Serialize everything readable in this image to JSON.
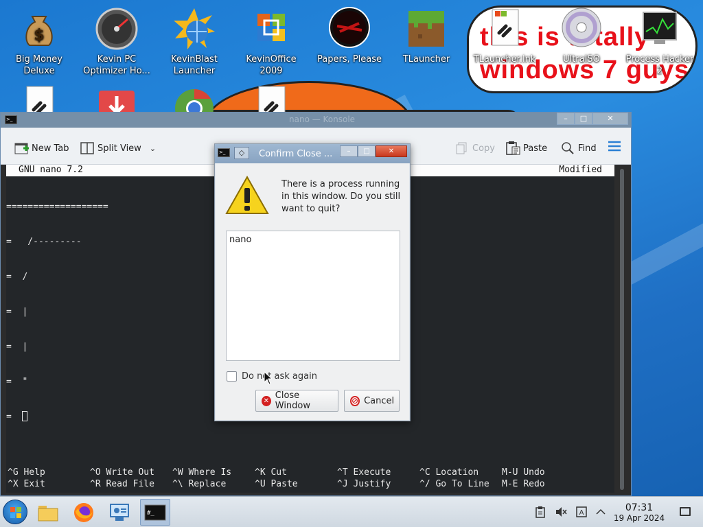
{
  "desktop": {
    "icons": [
      {
        "label": "Big Money\nDeluxe",
        "icon": "money-bag-icon"
      },
      {
        "label": "Kevin PC\nOptimizer Ho...",
        "icon": "speedometer-icon"
      },
      {
        "label": "KevinBlast\nLauncher",
        "icon": "blast-globe-icon"
      },
      {
        "label": "KevinOffice\n2009",
        "icon": "office-logo-icon"
      },
      {
        "label": "Papers, Please",
        "icon": "papers-please-icon"
      },
      {
        "label": "TLauncher",
        "icon": "grass-block-icon"
      },
      {
        "label": "TLauncher.lnk",
        "icon": "shortcut-file-icon"
      },
      {
        "label": "UltraISO",
        "icon": "disc-icon"
      },
      {
        "label": "Process Hacker\n2",
        "icon": "process-hacker-icon"
      }
    ],
    "sticker": {
      "line1": "this is totally",
      "line2": "windows 7 guys"
    }
  },
  "terminal": {
    "window_title": "nano — Konsole",
    "toolbar": {
      "new_tab": "New Tab",
      "split_view": "Split View",
      "copy": "Copy",
      "paste": "Paste",
      "find": "Find"
    },
    "nano": {
      "header_left": "GNU nano 7.2",
      "header_right": "Modified",
      "lines": [
        "===================",
        "=   /---------",
        "=  /",
        "=  |",
        "=  |",
        "=  \""
      ],
      "last_line_prefix": "=  ",
      "help": [
        {
          "key": "^G",
          "label": "Help"
        },
        {
          "key": "^X",
          "label": "Exit"
        },
        {
          "key": "^O",
          "label": "Write Out"
        },
        {
          "key": "^R",
          "label": "Read File"
        },
        {
          "key": "^W",
          "label": "Where Is"
        },
        {
          "key": "^\\",
          "label": "Replace"
        },
        {
          "key": "^K",
          "label": "Cut"
        },
        {
          "key": "^U",
          "label": "Paste"
        },
        {
          "key": "^T",
          "label": "Execute"
        },
        {
          "key": "^J",
          "label": "Justify"
        },
        {
          "key": "^C",
          "label": "Location"
        },
        {
          "key": "^/",
          "label": "Go To Line"
        },
        {
          "key": "M-U",
          "label": "Undo"
        },
        {
          "key": "M-E",
          "label": "Redo"
        }
      ]
    }
  },
  "dialog": {
    "title": "Confirm Close ...",
    "message": "There is a process running in this window. Do you still want to quit?",
    "process_list": [
      "nano"
    ],
    "checkbox_label": "Do not ask again",
    "close_button": "Close Window",
    "cancel_button": "Cancel"
  },
  "taskbar": {
    "apps": [
      "file-manager-icon",
      "firefox-icon",
      "control-panel-icon",
      "terminal-icon"
    ],
    "clock_time": "07:31",
    "clock_date": "19 Apr 2024"
  },
  "colors": {
    "accent": "#2a8de0",
    "terminal_bg": "#232629",
    "close_red": "#d32020"
  }
}
